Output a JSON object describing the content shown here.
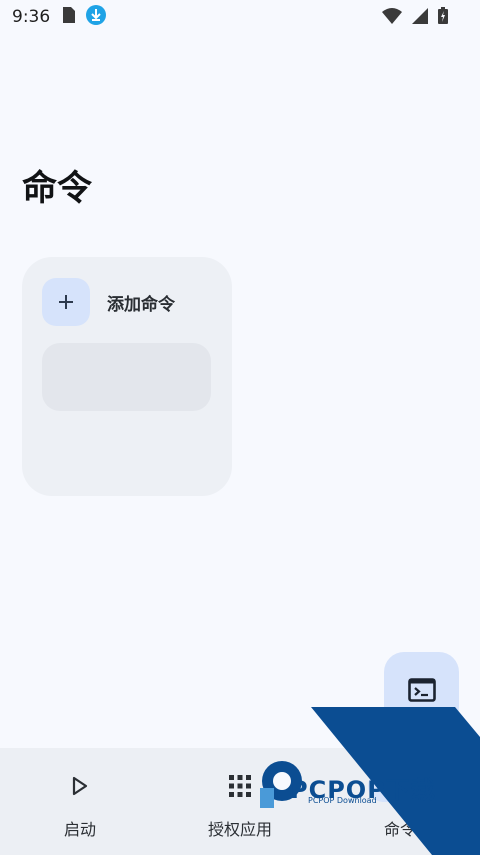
{
  "status_bar": {
    "time": "9:36"
  },
  "page": {
    "title": "命令"
  },
  "card": {
    "add_label": "添加命令"
  },
  "nav": {
    "items": [
      {
        "label": "启动",
        "icon": "play-icon"
      },
      {
        "label": "授权应用",
        "icon": "apps-grid-icon"
      },
      {
        "label": "命令",
        "icon": "terminal-icon",
        "active": true
      }
    ]
  },
  "watermark": {
    "text": "PCPOP下载",
    "subtext": "PCPOP Download"
  },
  "colors": {
    "background": "#f7f9fe",
    "accent_container": "#d6e3fb",
    "card": "#edf0f5",
    "nav_bg": "#eceff4",
    "watermark": "#0b4d92"
  }
}
